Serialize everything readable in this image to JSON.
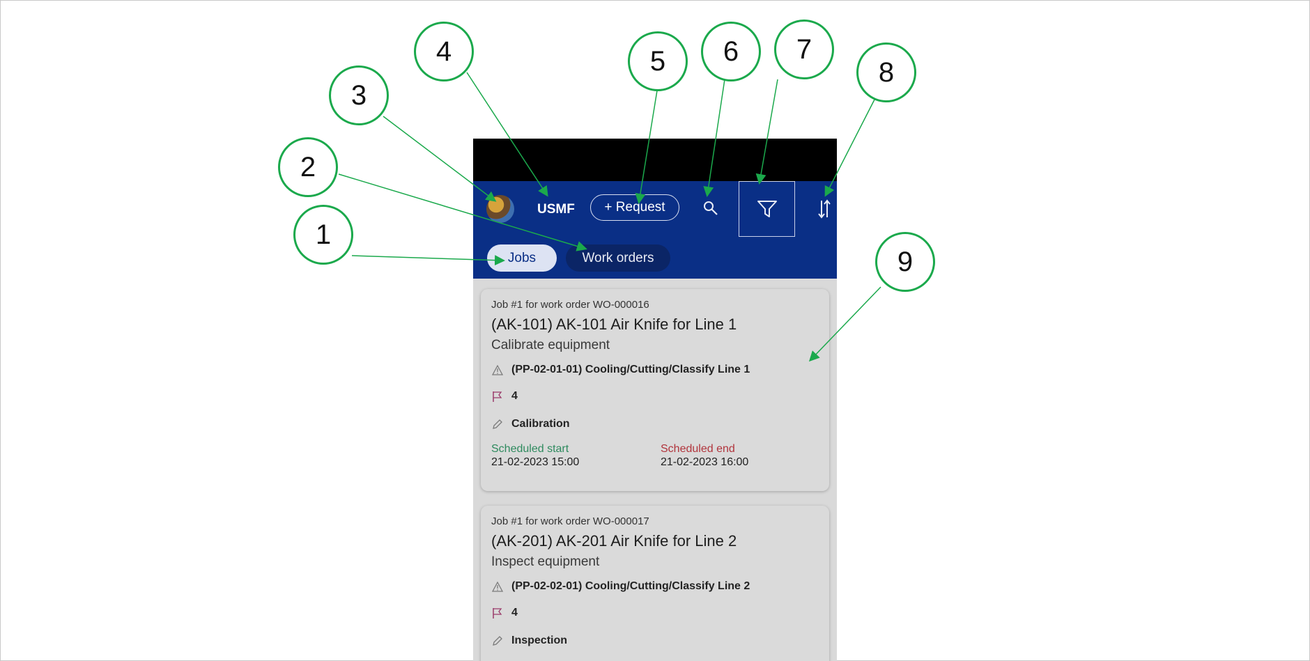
{
  "app": {
    "company": "USMF",
    "request_label": "+ Request",
    "tabs": [
      {
        "label": "Jobs",
        "selected": true
      },
      {
        "label": "Work orders",
        "selected": false
      }
    ]
  },
  "jobs": [
    {
      "subtitle": "Job #1 for work order WO-000016",
      "title": "(AK-101) AK-101 Air Knife for Line 1",
      "description": "Calibrate equipment",
      "location": "(PP-02-01-01) Cooling/Cutting/Classify Line 1",
      "priority": "4",
      "job_type": "Calibration",
      "scheduled_start_label": "Scheduled start",
      "scheduled_start": "21-02-2023 15:00",
      "scheduled_end_label": "Scheduled end",
      "scheduled_end": "21-02-2023 16:00"
    },
    {
      "subtitle": "Job #1 for work order WO-000017",
      "title": "(AK-201) AK-201 Air Knife for Line 2",
      "description": "Inspect equipment",
      "location": "(PP-02-02-01) Cooling/Cutting/Classify Line 2",
      "priority": "4",
      "job_type": "Inspection"
    }
  ],
  "callouts": [
    "1",
    "2",
    "3",
    "4",
    "5",
    "6",
    "7",
    "8",
    "9"
  ],
  "colors": {
    "appbar": "#0a2f86",
    "callout_green": "#1ba94c",
    "scheduled_start": "#2e8a5e",
    "scheduled_end": "#b1343c"
  },
  "icons": [
    "avatar",
    "search-icon",
    "filter-icon",
    "sort-icon",
    "location-warning-icon",
    "priority-flag-icon",
    "job-type-pencil-icon"
  ]
}
